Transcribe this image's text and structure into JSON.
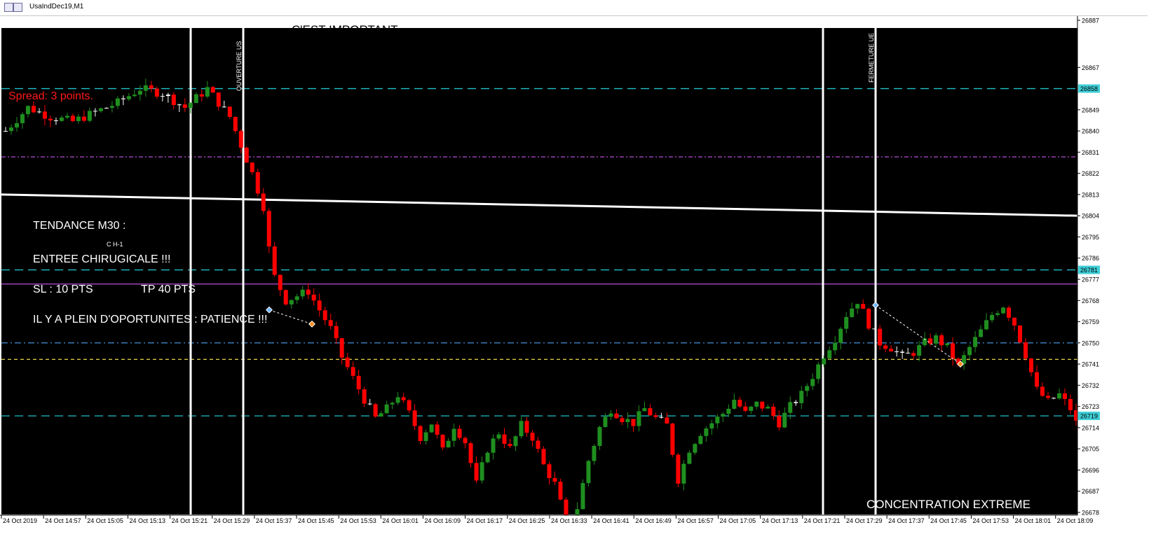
{
  "window": {
    "title": "UsaIndDec19,M1"
  },
  "colors": {
    "background": "#000000",
    "bull": "#1f8f1f",
    "bear": "#ff0000",
    "doji": "#ffffff",
    "cyan_line": "#20c0c8",
    "purple_line": "#b84ed8",
    "yellow_line": "#e8d44a",
    "blue_dash": "#3f84c8",
    "annotation_red": "#ff1a1a",
    "annotation_white": "#ffffff"
  },
  "annotations": {
    "important": "C'EST IMPORTANT",
    "spread": "Spread: 3 points.",
    "tendance": "TENDANCE M30 :",
    "ch1": "C H-1",
    "entree": "ENTREE CHIRUGICALE !!!",
    "sl": "SL : 10 PTS",
    "tp": "TP 40 PTS",
    "patience": "IL Y A PLEIN D'OPORTUNITES : PATIENCE !!!",
    "ouverture": "OUVERTURE US",
    "fermeture": "FERMETURE UE",
    "concentration": "CONCENTRATION EXTREME"
  },
  "chart_data": {
    "type": "candlestick",
    "symbol": "UsaIndDec19",
    "timeframe": "M1",
    "ylim": [
      26668,
      26890
    ],
    "y_ticks": [
      26887,
      26867,
      26849,
      26840,
      26831,
      26822,
      26813,
      26804,
      26795,
      26786,
      26777,
      26768,
      26759,
      26750,
      26741,
      26732,
      26723,
      26714,
      26705,
      26696,
      26687,
      26678
    ],
    "highlighted_levels": [
      {
        "value": 26858,
        "label": "26858"
      },
      {
        "value": 26781,
        "label": "26781"
      },
      {
        "value": 26719,
        "label": "26719"
      }
    ],
    "x_labels": [
      "24 Oct 2019",
      "24 Oct 14:57",
      "24 Oct 15:05",
      "24 Oct 15:13",
      "24 Oct 15:21",
      "24 Oct 15:29",
      "24 Oct 15:37",
      "24 Oct 15:45",
      "24 Oct 15:53",
      "24 Oct 16:01",
      "24 Oct 16:09",
      "24 Oct 16:17",
      "24 Oct 16:25",
      "24 Oct 16:33",
      "24 Oct 16:41",
      "24 Oct 16:49",
      "24 Oct 16:57",
      "24 Oct 17:05",
      "24 Oct 17:13",
      "24 Oct 17:21",
      "24 Oct 17:29",
      "24 Oct 17:37",
      "24 Oct 17:45",
      "24 Oct 17:53",
      "24 Oct 18:01",
      "24 Oct 18:09"
    ],
    "horizontal_lines": [
      {
        "value": 26858,
        "style": "dashed",
        "color": "cyan"
      },
      {
        "value": 26829,
        "style": "dashdot",
        "color": "purple"
      },
      {
        "value": 26781,
        "style": "dashed",
        "color": "cyan"
      },
      {
        "value": 26775,
        "style": "solid",
        "color": "purple"
      },
      {
        "value": 26750,
        "style": "dashdot",
        "color": "blue"
      },
      {
        "value": 26743,
        "style": "dashed",
        "color": "yellow"
      },
      {
        "value": 26719,
        "style": "dashed",
        "color": "cyan"
      }
    ],
    "moving_average": {
      "start": 26813,
      "end": 26804
    },
    "vertical_lines": [
      "24 Oct 15:22",
      "24 Oct 15:32",
      "24 Oct 17:21",
      "24 Oct 17:31"
    ],
    "trades": [
      {
        "from": 26764,
        "to": 26758
      },
      {
        "from": 26766,
        "to": 26741
      }
    ],
    "price_path": [
      [
        0,
        26840
      ],
      [
        4,
        26850
      ],
      [
        8,
        26846
      ],
      [
        12,
        26844
      ],
      [
        16,
        26848
      ],
      [
        20,
        26852
      ],
      [
        24,
        26858
      ],
      [
        28,
        26856
      ],
      [
        32,
        26850
      ],
      [
        36,
        26858
      ],
      [
        40,
        26846
      ],
      [
        41,
        26840
      ],
      [
        43,
        26828
      ],
      [
        44,
        26822
      ],
      [
        45,
        26815
      ],
      [
        46,
        26808
      ],
      [
        47,
        26790
      ],
      [
        48,
        26778
      ],
      [
        50,
        26768
      ],
      [
        52,
        26770
      ],
      [
        54,
        26772
      ],
      [
        56,
        26764
      ],
      [
        58,
        26756
      ],
      [
        60,
        26744
      ],
      [
        62,
        26735
      ],
      [
        64,
        26726
      ],
      [
        66,
        26718
      ],
      [
        68,
        26722
      ],
      [
        70,
        26728
      ],
      [
        72,
        26720
      ],
      [
        74,
        26710
      ],
      [
        76,
        26716
      ],
      [
        78,
        26704
      ],
      [
        80,
        26715
      ],
      [
        82,
        26708
      ],
      [
        84,
        26690
      ],
      [
        86,
        26705
      ],
      [
        88,
        26712
      ],
      [
        90,
        26705
      ],
      [
        92,
        26715
      ],
      [
        94,
        26710
      ],
      [
        96,
        26698
      ],
      [
        98,
        26690
      ],
      [
        100,
        26674
      ],
      [
        102,
        26680
      ],
      [
        104,
        26700
      ],
      [
        106,
        26714
      ],
      [
        108,
        26722
      ],
      [
        110,
        26718
      ],
      [
        112,
        26716
      ],
      [
        114,
        26722
      ],
      [
        116,
        26718
      ],
      [
        118,
        26715
      ],
      [
        120,
        26692
      ],
      [
        122,
        26705
      ],
      [
        124,
        26712
      ],
      [
        126,
        26716
      ],
      [
        128,
        26720
      ],
      [
        130,
        26726
      ],
      [
        132,
        26720
      ],
      [
        134,
        26724
      ],
      [
        136,
        26722
      ],
      [
        138,
        26716
      ],
      [
        140,
        26723
      ],
      [
        142,
        26728
      ],
      [
        144,
        26736
      ],
      [
        146,
        26745
      ],
      [
        148,
        26752
      ],
      [
        150,
        26762
      ],
      [
        152,
        26768
      ],
      [
        154,
        26758
      ],
      [
        156,
        26750
      ],
      [
        158,
        26748
      ],
      [
        160,
        26744
      ],
      [
        162,
        26746
      ],
      [
        164,
        26750
      ],
      [
        166,
        26752
      ],
      [
        168,
        26748
      ],
      [
        170,
        26740
      ],
      [
        172,
        26748
      ],
      [
        174,
        26755
      ],
      [
        176,
        26762
      ],
      [
        178,
        26766
      ],
      [
        180,
        26758
      ],
      [
        182,
        26745
      ],
      [
        184,
        26730
      ],
      [
        186,
        26725
      ],
      [
        188,
        26728
      ],
      [
        190,
        26722
      ],
      [
        191,
        26716
      ]
    ]
  }
}
